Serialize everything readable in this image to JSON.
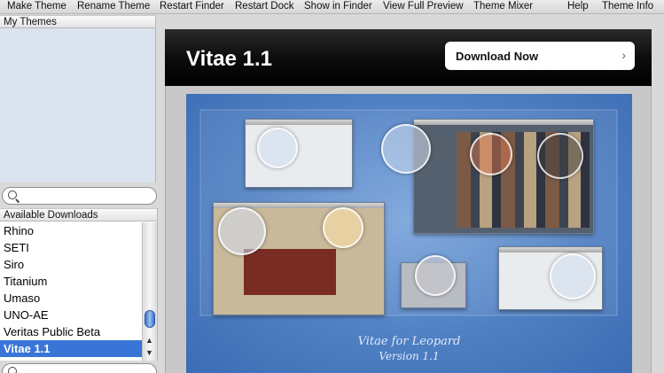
{
  "toolbar": {
    "items": [
      "Make Theme",
      "Rename Theme",
      "Restart Finder",
      "Restart Dock",
      "Show in Finder",
      "View Full Preview",
      "Theme Mixer",
      "Help",
      "Theme Info"
    ]
  },
  "sidebar": {
    "my_themes_header": "My Themes",
    "downloads_header": "Available Downloads",
    "downloads": [
      "Rhino",
      "SETI",
      "Siro",
      "Titanium",
      "Umaso",
      "UNO-AE",
      "Veritas Public Beta",
      "Vitae 1.1"
    ],
    "selected": "Vitae 1.1"
  },
  "detail": {
    "title": "Vitae 1.1",
    "download_label": "Download Now",
    "caption_line1": "Vitae for Leopard",
    "caption_line2": "Version 1.1"
  },
  "icons": {
    "search": "search-icon",
    "chevron": "chevron-right-icon"
  },
  "colors": {
    "selection": "#3875d7",
    "preview_bg": "#4f80c3",
    "banner_bg": "#000000"
  }
}
